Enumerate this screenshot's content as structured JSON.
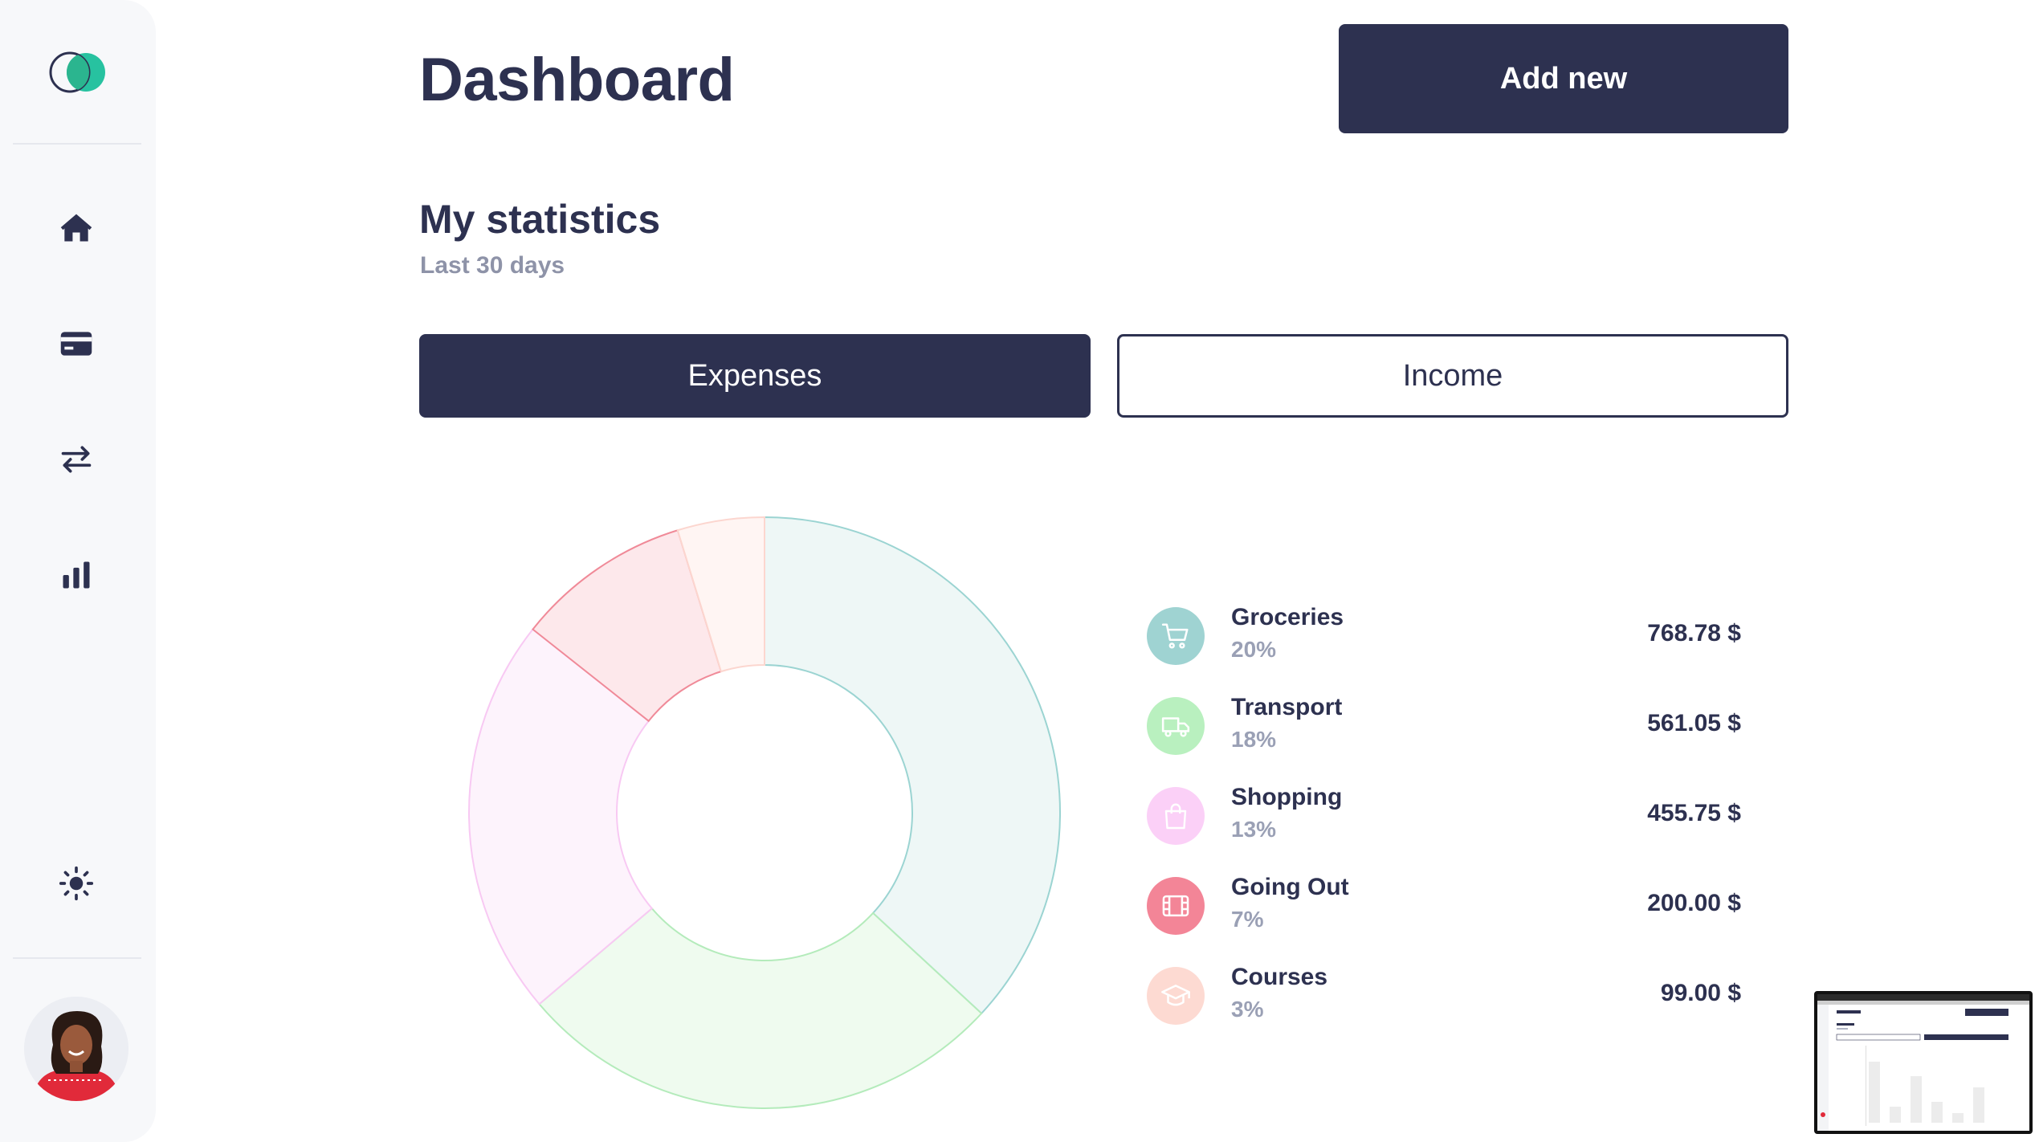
{
  "header": {
    "title": "Dashboard",
    "add_label": "Add new"
  },
  "stats": {
    "title": "My statistics",
    "subtitle": "Last 30 days"
  },
  "tabs": [
    {
      "label": "Expenses",
      "active": true
    },
    {
      "label": "Income",
      "active": false
    }
  ],
  "sidebar": {
    "icons": [
      "home-icon",
      "card-icon",
      "transfer-icon",
      "bar-chart-icon"
    ],
    "bottom_icon": "sun-icon"
  },
  "chart_data": {
    "type": "pie",
    "donut": true,
    "categories": [
      "Groceries",
      "Transport",
      "Shopping",
      "Going Out",
      "Courses"
    ],
    "values": [
      768.78,
      561.05,
      455.75,
      200.0,
      99.0
    ],
    "percents": [
      20,
      18,
      13,
      7,
      3
    ],
    "colors": {
      "fill": [
        "#eef7f6",
        "#effbef",
        "#fdf3fc",
        "#fde8eb",
        "#fff5f3"
      ],
      "stroke": [
        "#9bd4d2",
        "#b4ebbb",
        "#f8c9f3",
        "#f08a98",
        "#fcd6cf"
      ]
    }
  },
  "legend": [
    {
      "name": "Groceries",
      "percent": "20%",
      "amount": "768.78 $",
      "icon": "cart-icon",
      "icon_bg": "#9fd3d2"
    },
    {
      "name": "Transport",
      "percent": "18%",
      "amount": "561.05 $",
      "icon": "truck-icon",
      "icon_bg": "#b9f0bf"
    },
    {
      "name": "Shopping",
      "percent": "13%",
      "amount": "455.75 $",
      "icon": "bag-icon",
      "icon_bg": "#fbd0f7"
    },
    {
      "name": "Going Out",
      "percent": "7%",
      "amount": "200.00 $",
      "icon": "film-icon",
      "icon_bg": "#f38597"
    },
    {
      "name": "Courses",
      "percent": "3%",
      "amount": "99.00 $",
      "icon": "graduation-cap-icon",
      "icon_bg": "#fddad2"
    }
  ],
  "theme": {
    "primary": "#2d3150",
    "muted": "#8e93a8"
  }
}
